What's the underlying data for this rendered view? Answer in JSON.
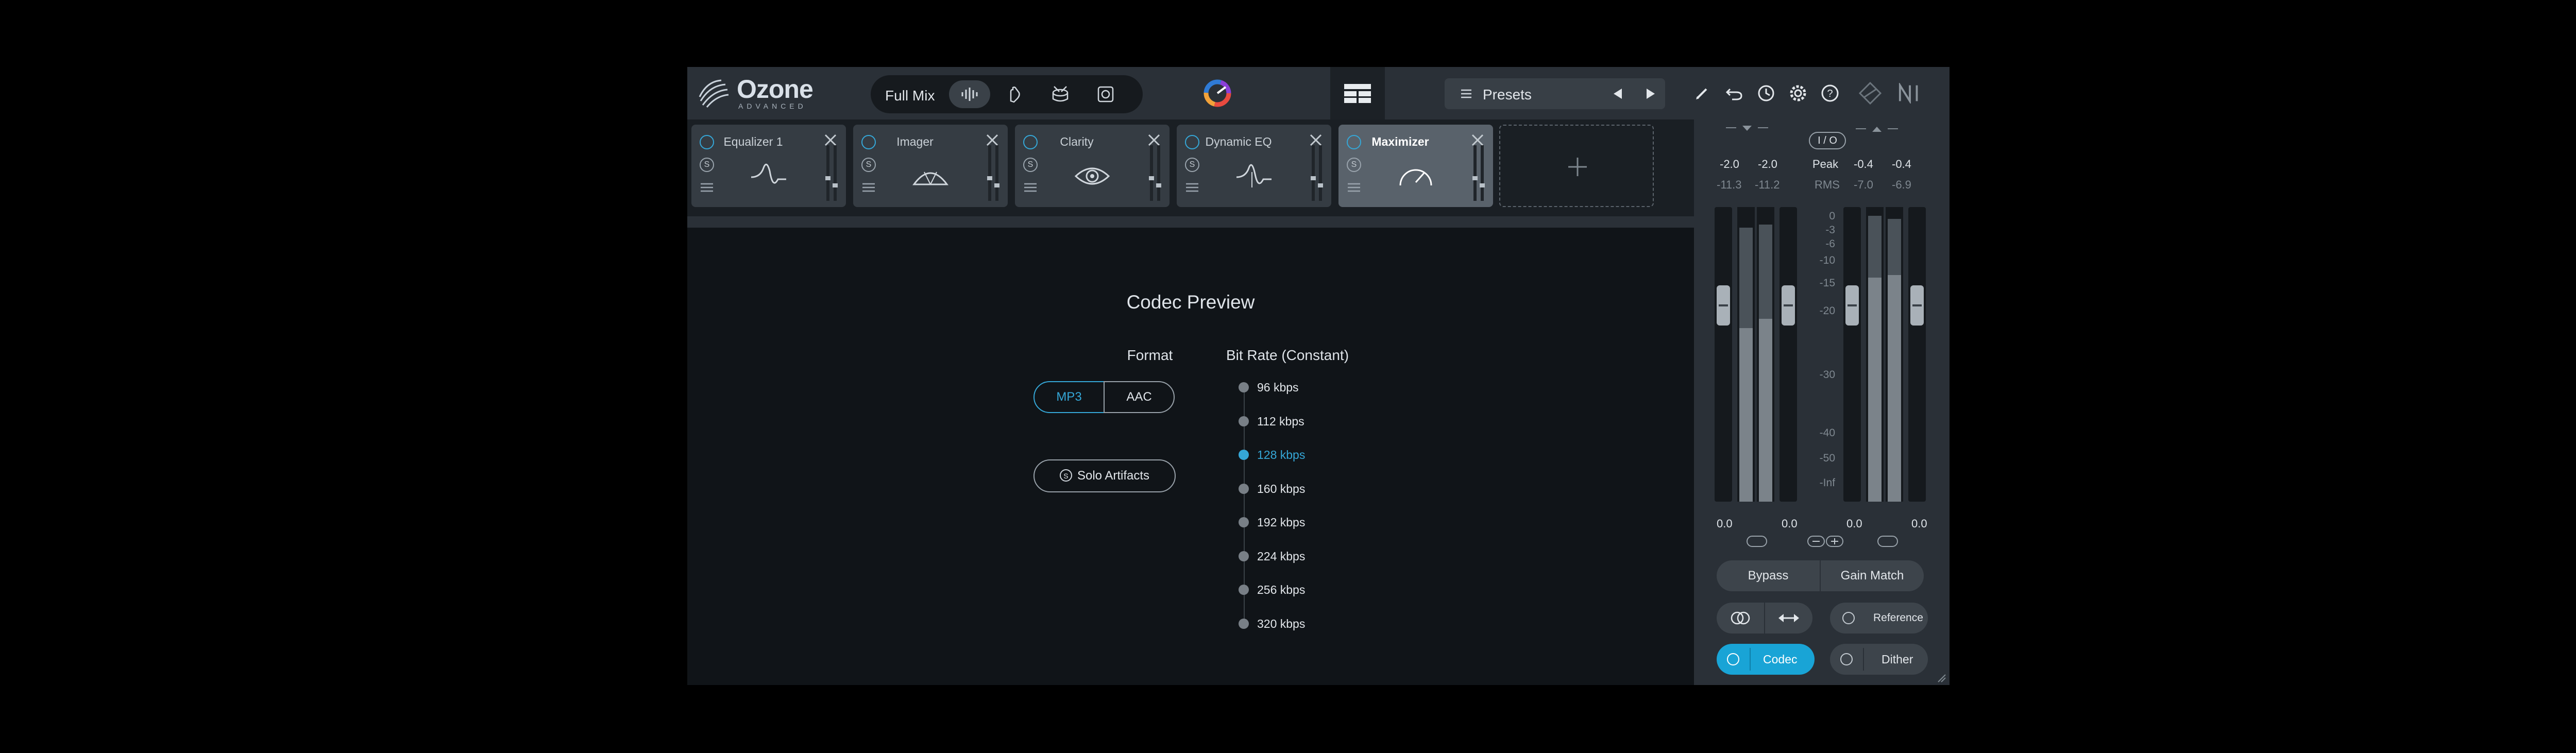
{
  "app": {
    "logo_text": "Ozone",
    "logo_sub": "ADVANCED"
  },
  "assistant": {
    "full_mix_label": "Full Mix",
    "icons": [
      "waveform-icon",
      "hand-icon",
      "drum-icon",
      "speaker-icon"
    ]
  },
  "presets": {
    "label": "Presets"
  },
  "modules": [
    {
      "name": "Equalizer 1",
      "glyph": "eq-curve-icon",
      "active": false
    },
    {
      "name": "Imager",
      "glyph": "imager-icon",
      "active": false
    },
    {
      "name": "Clarity",
      "glyph": "eye-icon",
      "active": false
    },
    {
      "name": "Dynamic EQ",
      "glyph": "dynamic-eq-icon",
      "active": false
    },
    {
      "name": "Maximizer",
      "glyph": "gauge-icon",
      "active": true
    }
  ],
  "codec": {
    "title": "Codec Preview",
    "format_label": "Format",
    "format_options": [
      "MP3",
      "AAC"
    ],
    "format_selected": "MP3",
    "solo_label": "Solo Artifacts",
    "solo_glyph": "S",
    "bitrate_label": "Bit Rate (Constant)",
    "bitrates": [
      "96 kbps",
      "112 kbps",
      "128 kbps",
      "160 kbps",
      "192 kbps",
      "224 kbps",
      "256 kbps",
      "320 kbps"
    ],
    "bitrate_selected": "128 kbps"
  },
  "meters": {
    "in_peak_l": "-2.0",
    "in_peak_r": "-2.0",
    "in_rms_l": "-11.3",
    "in_rms_r": "-11.2",
    "peak_label": "Peak",
    "rms_label": "RMS",
    "io_label": "I / O",
    "out_peak_l": "-0.4",
    "out_peak_r": "-0.4",
    "out_rms_l": "-7.0",
    "out_rms_r": "-6.9",
    "scale": [
      "0",
      "-3",
      "-6",
      "-10",
      "-15",
      "-20",
      "-30",
      "-40",
      "-50",
      "-Inf"
    ],
    "gain_in_l": "0.0",
    "gain_in_r": "0.0",
    "gain_out_l": "0.0",
    "gain_out_r": "0.0",
    "in_levels": {
      "l_peak": 0.93,
      "r_peak": 0.94,
      "l_rms": 0.59,
      "r_rms": 0.62
    },
    "out_levels": {
      "l_peak": 0.97,
      "r_peak": 0.96,
      "l_rms": 0.76,
      "r_rms": 0.77
    }
  },
  "buttons": {
    "bypass": "Bypass",
    "gain_match": "Gain Match",
    "reference": "Reference",
    "codec": "Codec",
    "dither": "Dither"
  },
  "colors": {
    "accent": "#35a7d7",
    "codec_active": "#19a4d6"
  }
}
